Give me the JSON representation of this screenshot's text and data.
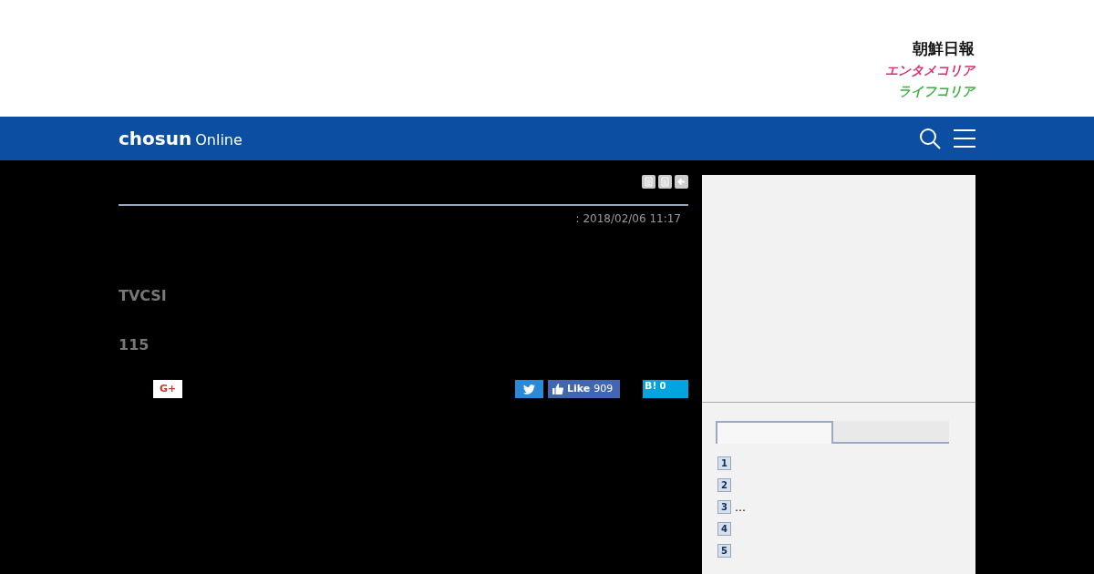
{
  "header": {
    "logos": [
      {
        "text": "朝鮮日報",
        "color": "#111111"
      },
      {
        "text": "エンタメコリア",
        "color": "#d6336c"
      },
      {
        "text": "ライフコリア",
        "color": "#3cb043"
      }
    ]
  },
  "navbar": {
    "brand": "chosun",
    "brand_suffix": "Online"
  },
  "article": {
    "date": ": 2018/02/06 11:17",
    "paragraphs": [
      "TVCSI",
      "115"
    ],
    "share": {
      "gplus": "G+",
      "like": "Like",
      "like_count": "909",
      "hatena": "B!",
      "hatena_count": "0"
    }
  },
  "sidebar": {
    "tabs": [
      {
        "selected": true
      },
      {
        "selected": false
      }
    ],
    "ranking": [
      {
        "rank": "1"
      },
      {
        "rank": "2"
      },
      {
        "rank": "3",
        "title": "…"
      },
      {
        "rank": "4"
      },
      {
        "rank": "5"
      }
    ]
  }
}
